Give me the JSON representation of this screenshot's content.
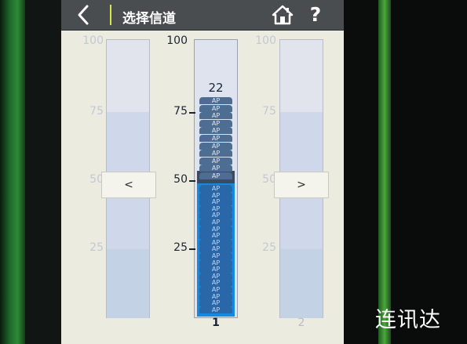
{
  "header": {
    "title": "选择信道",
    "back_icon": "back-arrow-icon",
    "home_icon": "home-icon",
    "help_label": "?"
  },
  "channel_columns": {
    "left": {
      "ticks": [
        "100",
        "75",
        "50",
        "25"
      ],
      "nav_label": "<"
    },
    "middle": {
      "ticks": [
        "100",
        "75",
        "50",
        "25"
      ],
      "ap_count_label": "22",
      "channel_number": "1",
      "ap_label": "AP",
      "upper_ap_count": 11,
      "lower_ap_count": 19
    },
    "right": {
      "ticks": [
        "100",
        "75",
        "50",
        "25"
      ],
      "nav_label": ">",
      "channel_number": "2"
    }
  },
  "watermark": "连讯达",
  "colors": {
    "accent_green": "#d8e84a",
    "bar_blue": "#1489e0",
    "titlebar": "#4a4d50"
  }
}
